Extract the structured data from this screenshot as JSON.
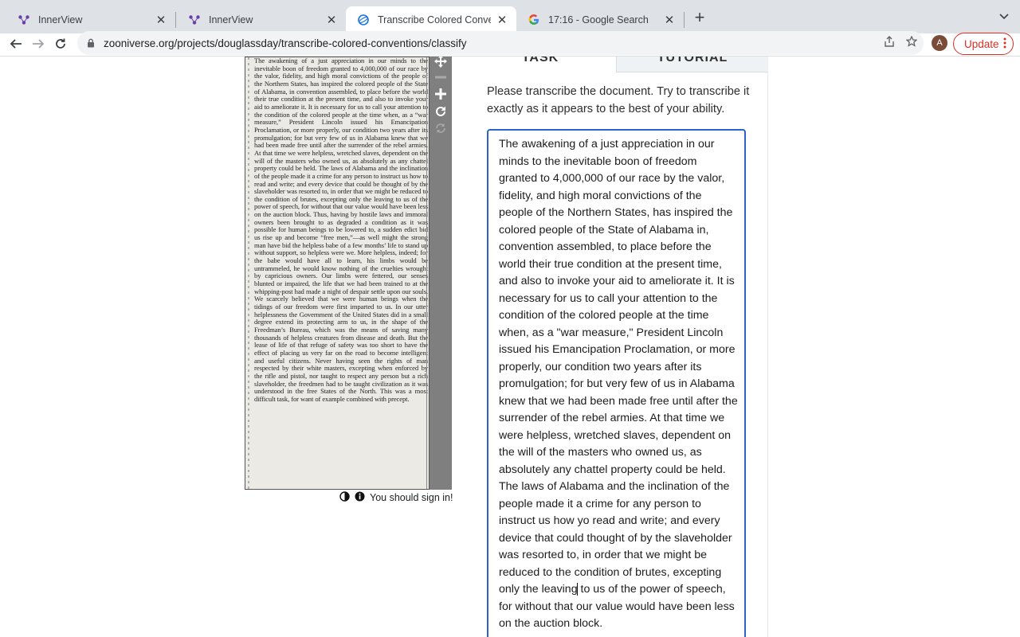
{
  "browser": {
    "tabs": [
      {
        "title": "InnerView"
      },
      {
        "title": "InnerView"
      },
      {
        "title": "Transcribe Colored Convention"
      },
      {
        "title": "17:16 - Google Search"
      }
    ],
    "url": "zooniverse.org/projects/douglassday/transcribe-colored-conventions/classify",
    "avatar_letter": "A",
    "update_label": "Update"
  },
  "viewer": {
    "scan_text": "The awakening of a just appreciation in our minds to the inevitable boon of freedom granted to 4,000,000 of our race by the valor, fidelity, and high moral convictions of the people of the Northern States, has inspired the colored people of the State of Alabama, in convention assembled, to place before the world their true condition at the present time, and also to invoke your aid to ameliorate it. It is necessary for us to call your attention to the condition of the colored people at the time when, as a “war measure,” President Lincoln issued his Emancipation Proclamation, or more properly, our condition two years after its promulgation; for but very few of us in Alabama knew that we had been made free until after the surrender of the rebel armies. At that time we were helpless, wretched slaves, dependent on the will of the masters who owned us, as absolutely as any chattel property could be held. The laws of Alabama and the inclination of the people made it a crime for any person to instruct us how to read and write; and every device that could be thought of by the slaveholder was resorted to, in order that we might be reduced to the condition of brutes, excepting only the leaving to us of the power of speech, for without that our value would have been less on the auction block. Thus, having by hostile laws and immoral owners been brought to as degraded a condition as it was possible for human beings to be lowered to, a sudden edict bid us rise up and become “free men,”—as well might the strong man have bid the helpless babe of a few months’ life to stand up without support, so helpless were we. More helpless, indeed; for the babe would have all to learn, his limbs would be untrammeled, he would know nothing of the cruelties wrought by capricious owners. Our limbs were fettered, our senses blunted or impaired, the life that we had been trained to at the whipping-post had made a night of despair settle upon our souls. We scarcely believed that we were human beings when the tidings of our freedom were first imparted to us. In our utter helplessness the Government of the United States did in a small degree extend its protecting arm to us, in the shape of the Freedman’s Bureau, which was the means of saving many thousands of helpless creatures from disease and death. But the lease of life of that refuge of safety was too short to have the effect of placing us very far on the road to become intelligent and useful citizens. Never having seen the rights of man respected by their white masters, excepting when enforced by the rifle and pistol, nor taught to respect any person but a rich slaveholder, the freedmen had to be taught civilization as it was understood in the free States of the North. This was a most difficult task, for want of example combined with precept.",
    "sign_in_text": "You should sign in!"
  },
  "task_panel": {
    "tab_task": "TASK",
    "tab_tutorial": "TUTORIAL",
    "instruction": "Please transcribe the document. Try to transcribe it exactly as it appears to the best of your ability.",
    "transcription_before_caret": "The awakening of a just appreciation in our minds to the inevitable boon of freedom granted to 4,000,000 of our race by the valor, fidelity, and high moral convictions of the people of the Northern States, has inspired the colored people of the State of Alabama in, convention assembled, to place before the world their true condition at the present time, and also to invoke your aid to ameliorate it. It is necessary for us to call your attention to the condition of the colored people at the time when, as a \"war measure,\" President Lincoln issued his Emancipation Proclamation, or more properly, our condition two years after its promulgation; for but very few of us in Alabama knew that we had been made free until after the surrender of the rebel armies. At that time we were helpless, wretched slaves, dependent on the will of the masters who owned us, as absolutely any chattel property could be held. The laws of Alabama and the inclination of the people made it a crime for any person to instruct us how yo read and write; and every device that could thought of by the slaveholder was resorted to, in order that we might be reduced to the condition of brutes, excepting only the leaving",
    "transcription_after_caret": " to us of the power of speech, for without that our value would have been less on the auction block."
  }
}
